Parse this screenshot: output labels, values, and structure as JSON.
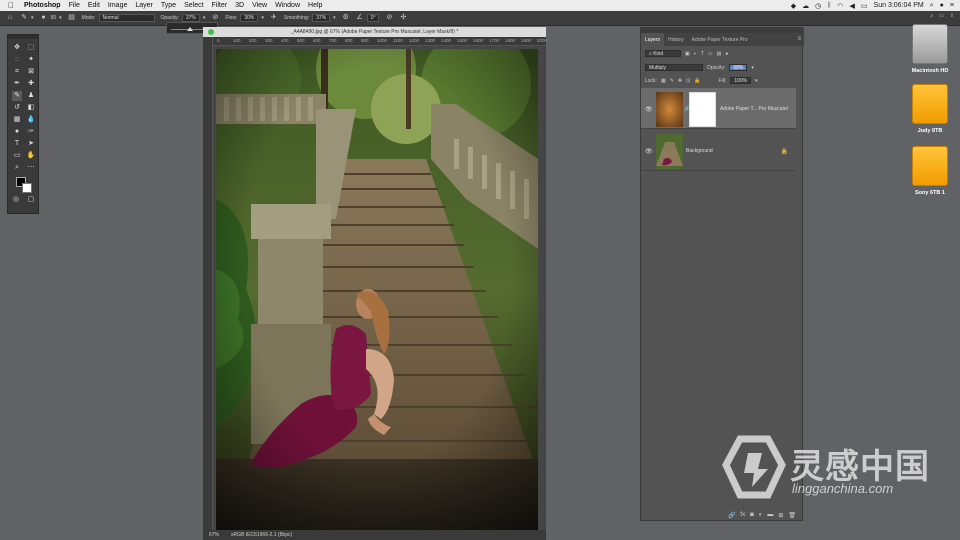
{
  "menubar": {
    "app": "Photoshop",
    "items": [
      "File",
      "Edit",
      "Image",
      "Layer",
      "Type",
      "Select",
      "Filter",
      "3D",
      "View",
      "Window",
      "Help"
    ],
    "clock": "Sun 3:06:04 PM"
  },
  "options": {
    "brush_size": "50",
    "mode_label": "Mode:",
    "mode_value": "Normal",
    "opacity_label": "Opacity:",
    "opacity_value": "37%",
    "flow_label": "Flow:",
    "flow_value": "30%",
    "smoothing_label": "Smoothing:",
    "smoothing_value": "37%",
    "angle_value": "0°"
  },
  "document": {
    "title": "_A4A8490.jpg @ 67% (Adobe Paper Texture Pro Muscatel, Layer Mask/8) *",
    "ruler_ticks": [
      "0",
      "100",
      "200",
      "300",
      "400",
      "500",
      "600",
      "700",
      "800",
      "900",
      "1000",
      "1100",
      "1200",
      "1300",
      "1400",
      "1500",
      "1600",
      "1700",
      "1800",
      "1900",
      "2000"
    ],
    "zoom": "67%",
    "profile": "sRGB IEC61966-2.1 (8bpc)"
  },
  "layers_panel": {
    "tabs": [
      "Layers",
      "History",
      "Adobe Paper Texture Pro"
    ],
    "filter_kind": "Kind",
    "blend_mode": "Multiply",
    "opacity_label": "Opacity:",
    "opacity_value": "68%",
    "lock_label": "Lock:",
    "fill_label": "Fill:",
    "fill_value": "100%",
    "layers": [
      {
        "name": "Adobe Paper T... Pro Muscatel",
        "selected": true
      },
      {
        "name": "Background",
        "selected": false
      }
    ],
    "footer_icons": [
      "link-icon",
      "fx-icon",
      "mask-icon",
      "adjustment-icon",
      "folder-icon",
      "new-layer-icon",
      "trash-icon"
    ],
    "fx_label": "fx"
  },
  "desktop": {
    "disks": [
      "Macintosh HD",
      "Judy 8TB",
      "Sony 6TB 1"
    ]
  },
  "watermark": {
    "chinese": "灵感中国",
    "url": "lingganchina.com"
  }
}
